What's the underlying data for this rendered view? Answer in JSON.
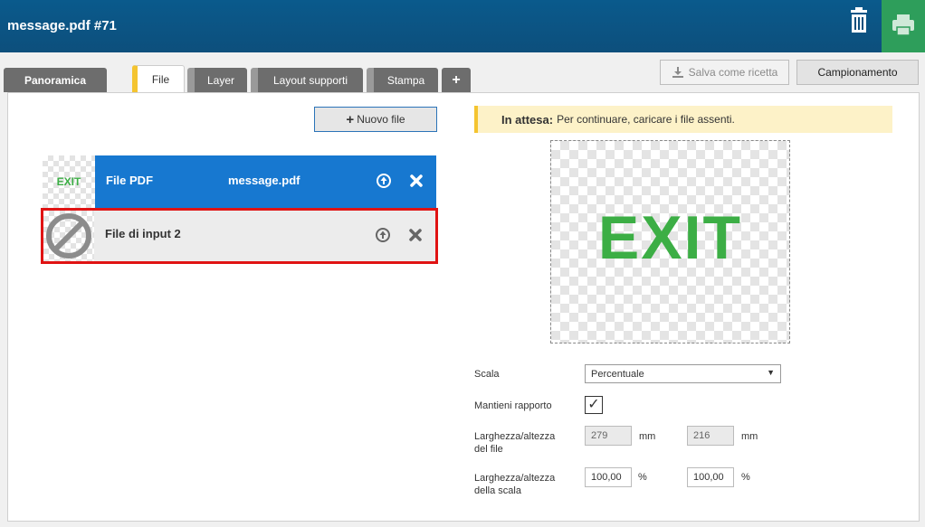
{
  "header": {
    "title": "message.pdf #71"
  },
  "tabs": [
    {
      "label": "Panoramica"
    },
    {
      "label": "File"
    },
    {
      "label": "Layer"
    },
    {
      "label": "Layout supporti"
    },
    {
      "label": "Stampa"
    },
    {
      "label": "+"
    }
  ],
  "toolbar": {
    "save_recipe_label": "Salva come ricetta",
    "sampling_label": "Campionamento"
  },
  "files": {
    "new_file_label": "Nuovo file",
    "rows": [
      {
        "thumb_text": "EXIT",
        "label": "File PDF",
        "filename": "message.pdf"
      },
      {
        "thumb_text": "",
        "label": "File di input 2",
        "filename": ""
      }
    ]
  },
  "status": {
    "title": "In attesa:",
    "message": "Per continuare, caricare i file assenti."
  },
  "preview": {
    "text": "EXIT"
  },
  "settings": {
    "scale_label": "Scala",
    "scale_value": "Percentuale",
    "keep_ratio_label": "Mantieni rapporto",
    "keep_ratio_checked": "✓",
    "file_size_label_1": "Larghezza/altezza",
    "file_size_label_2": "del file",
    "file_width": "279",
    "file_height": "216",
    "file_unit": "mm",
    "scale_size_label_1": "Larghezza/altezza",
    "scale_size_label_2": "della scala",
    "scale_width": "100,00",
    "scale_height": "100,00",
    "scale_unit": "%"
  },
  "colors": {
    "header": "#0d4f7c",
    "print_button": "#2e9e5b",
    "selected_row": "#1778d0",
    "highlight": "#e01313",
    "exit_green": "#3cae45",
    "tab_accent": "#f4c430"
  }
}
